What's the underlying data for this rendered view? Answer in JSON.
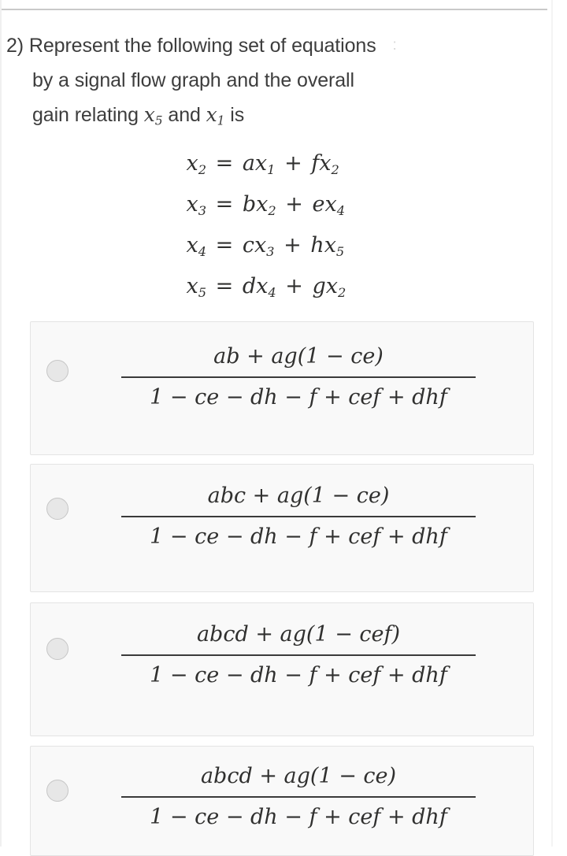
{
  "question": {
    "number": "2)",
    "line1": "Represent the following set of equations",
    "line2": "by a signal flow graph and the overall",
    "line3_pre": "gain relating",
    "line3_var1": "x",
    "line3_var1_sub": "5",
    "line3_mid": "and",
    "line3_var2": "x",
    "line3_var2_sub": "1",
    "line3_post": "is",
    "artifact": ":"
  },
  "equations": [
    {
      "lhs": "x",
      "lhs_sub": "2",
      "eq": "=",
      "t1_coef": "a",
      "t1_var": "x",
      "t1_sub": "1",
      "plus": "+",
      "t2_coef": "f",
      "t2_var": "x",
      "t2_sub": "2"
    },
    {
      "lhs": "x",
      "lhs_sub": "3",
      "eq": "=",
      "t1_coef": "b",
      "t1_var": "x",
      "t1_sub": "2",
      "plus": "+",
      "t2_coef": "e",
      "t2_var": "x",
      "t2_sub": "4"
    },
    {
      "lhs": "x",
      "lhs_sub": "4",
      "eq": "=",
      "t1_coef": "c",
      "t1_var": "x",
      "t1_sub": "3",
      "plus": "+",
      "t2_coef": "h",
      "t2_var": "x",
      "t2_sub": "5"
    },
    {
      "lhs": "x",
      "lhs_sub": "5",
      "eq": "=",
      "t1_coef": "d",
      "t1_var": "x",
      "t1_sub": "4",
      "plus": "+",
      "t2_coef": "g",
      "t2_var": "x",
      "t2_sub": "2"
    }
  ],
  "options": [
    {
      "id": "option-a",
      "numerator": "ab + ag(1 − ce)",
      "denominator": "1 − ce − dh − f + cef + dhf",
      "selected": false
    },
    {
      "id": "option-b",
      "numerator": "abc + ag(1 − ce)",
      "denominator": "1 − ce − dh − f + cef + dhf",
      "selected": false
    },
    {
      "id": "option-c",
      "numerator": "abcd + ag(1 − cef)",
      "denominator": "1 − ce − dh − f + cef + dhf",
      "selected": false
    },
    {
      "id": "option-d",
      "numerator": "abcd + ag(1 − ce)",
      "denominator": "1 − ce − dh − f + cef + dhf",
      "selected": false
    }
  ],
  "colors": {
    "page_background": "#ffffff",
    "card_background": "#f9f9f9",
    "card_border": "#e4e4e4",
    "radio_fill": "#e7e7e7",
    "radio_border": "#c6c6c6",
    "text": "#3d3d3d",
    "math_text": "#30302f",
    "divider": "#c9c9c9"
  }
}
